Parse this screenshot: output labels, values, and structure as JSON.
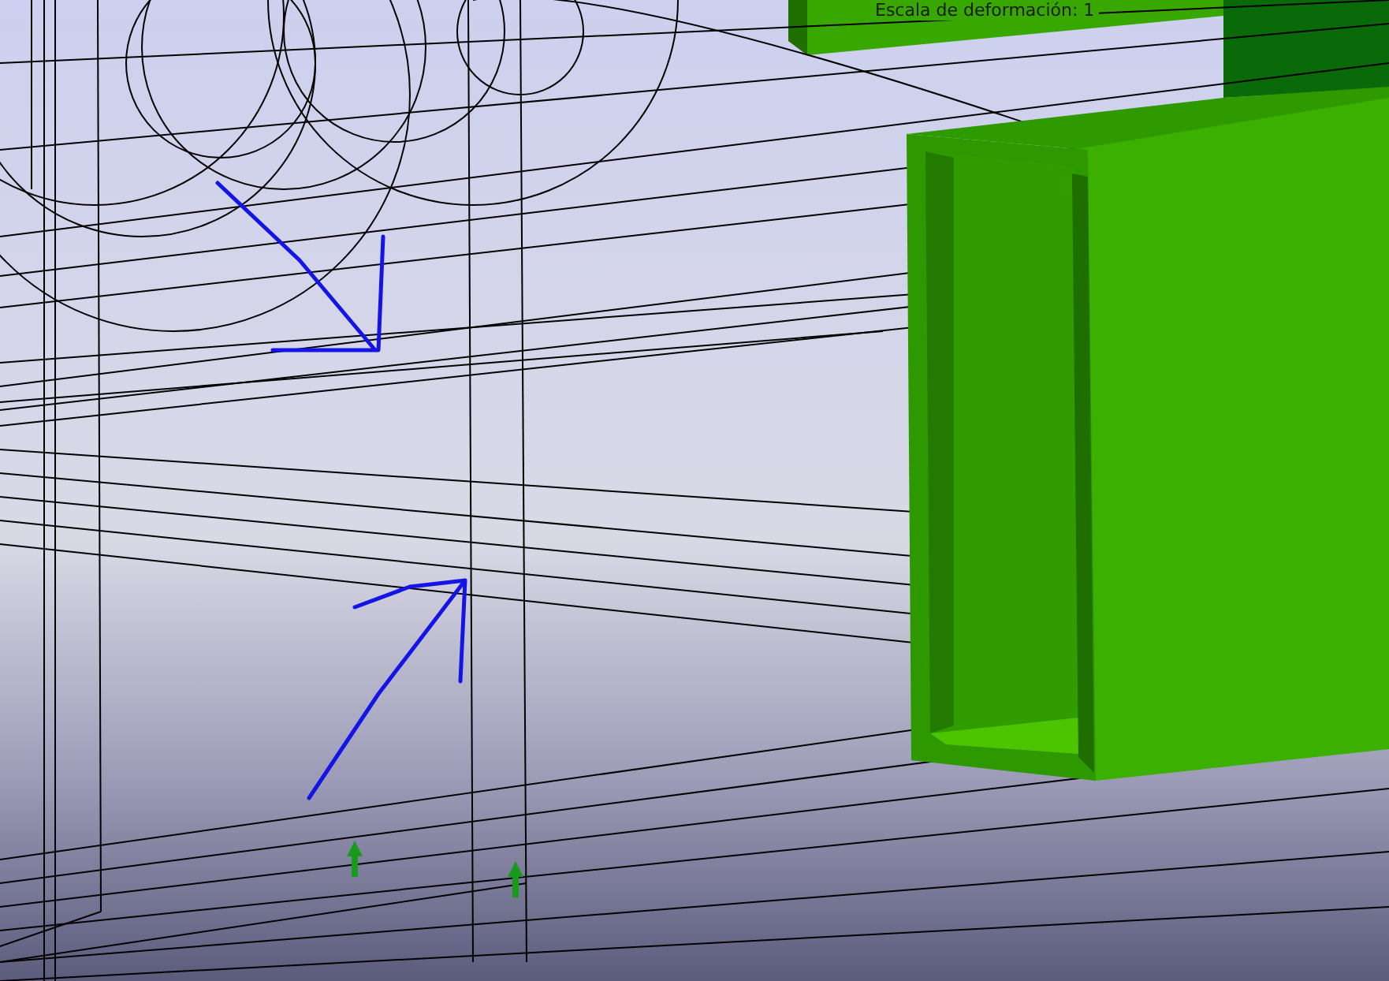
{
  "viewport": {
    "caption": "Escala de deformación: 1"
  }
}
